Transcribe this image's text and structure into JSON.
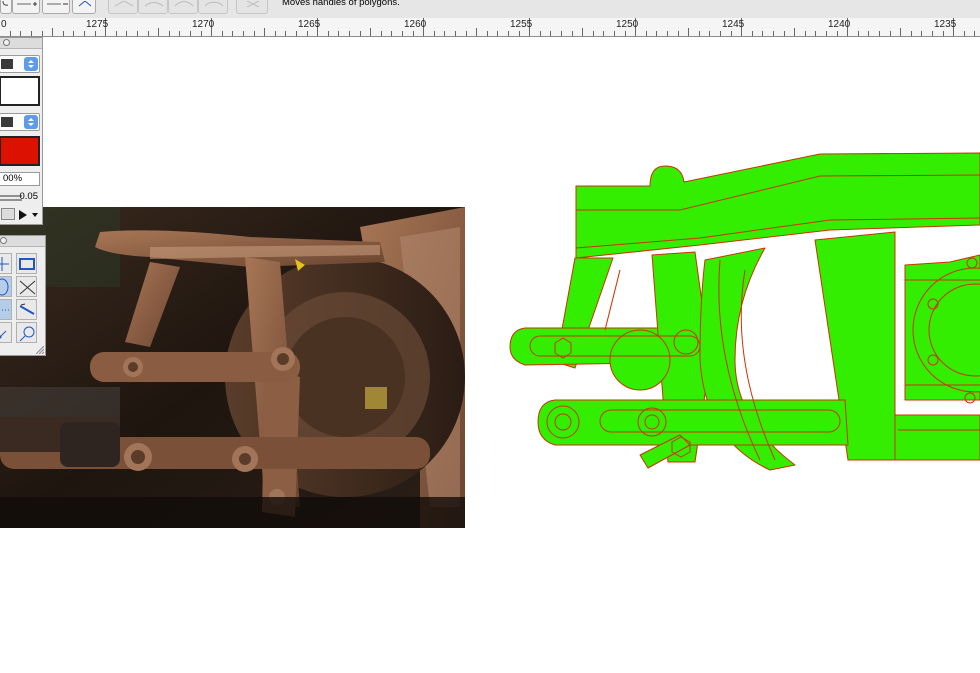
{
  "toolbar": {
    "status_text": "Moves handles of polygons.",
    "tools": [
      {
        "name": "add-point-icon",
        "enabled": true
      },
      {
        "name": "remove-point-icon",
        "enabled": true
      },
      {
        "name": "reverse-path-icon",
        "enabled": true
      },
      {
        "name": "curve-corner-icon",
        "enabled": false
      },
      {
        "name": "curve-smooth-icon",
        "enabled": false
      },
      {
        "name": "curve-arc-icon",
        "enabled": false
      },
      {
        "name": "curve-bezier-icon",
        "enabled": false
      },
      {
        "name": "delete-icon",
        "enabled": false
      }
    ]
  },
  "ruler": {
    "labels": [
      "0",
      "1275",
      "1270",
      "1265",
      "1260",
      "1255",
      "1250",
      "1245",
      "1240",
      "1235"
    ]
  },
  "style_palette": {
    "stroke_color": "#3a3a3a",
    "stroke_preview_color": "#ffffff",
    "fill_color": "#3a3a3a",
    "fill_preview_color": "#dd1100",
    "opacity_value": "00%",
    "line_width_value": "0.05"
  },
  "tool_palette": {
    "tools": [
      "crosshair-icon",
      "rectangle-icon",
      "ellipse-icon",
      "line-cross-icon",
      "dotted-line-icon",
      "pen-icon",
      "arrow-icon",
      "circle-line-icon"
    ]
  },
  "canvas": {
    "shape_fill": "#33ee00",
    "shape_stroke": "#cc3300",
    "photo_description_icon": "photo-icon"
  }
}
